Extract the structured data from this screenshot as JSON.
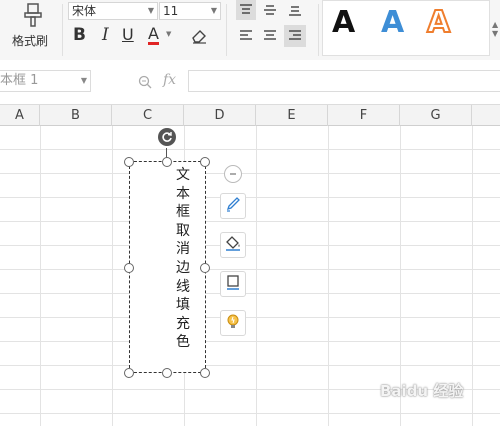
{
  "ribbon": {
    "format_painter_label": "格式刷",
    "font_name": "宋体",
    "font_size": "11",
    "bold_label": "B",
    "italic_label": "I",
    "underline_label": "U",
    "font_color_label": "A",
    "font_color": "#e02424",
    "wordart_letter": "A",
    "wordart_colors": [
      "#111111",
      "#3e8ed6",
      "#ef7e2e"
    ]
  },
  "formula_bar": {
    "name_box_value": "本框  1",
    "zoom_icon": "magnifier-icon",
    "fx_label": "fx"
  },
  "columns": [
    "A",
    "B",
    "C",
    "D",
    "E",
    "F",
    "G"
  ],
  "textbox": {
    "text": "文本框取消边线填充色"
  },
  "float_toolbar": {
    "collapse_icon": "minus-circle-icon",
    "items": [
      "pen-icon",
      "fill-bucket-icon",
      "border-icon",
      "lightbulb-icon"
    ]
  },
  "watermark": "Baidu 经验"
}
